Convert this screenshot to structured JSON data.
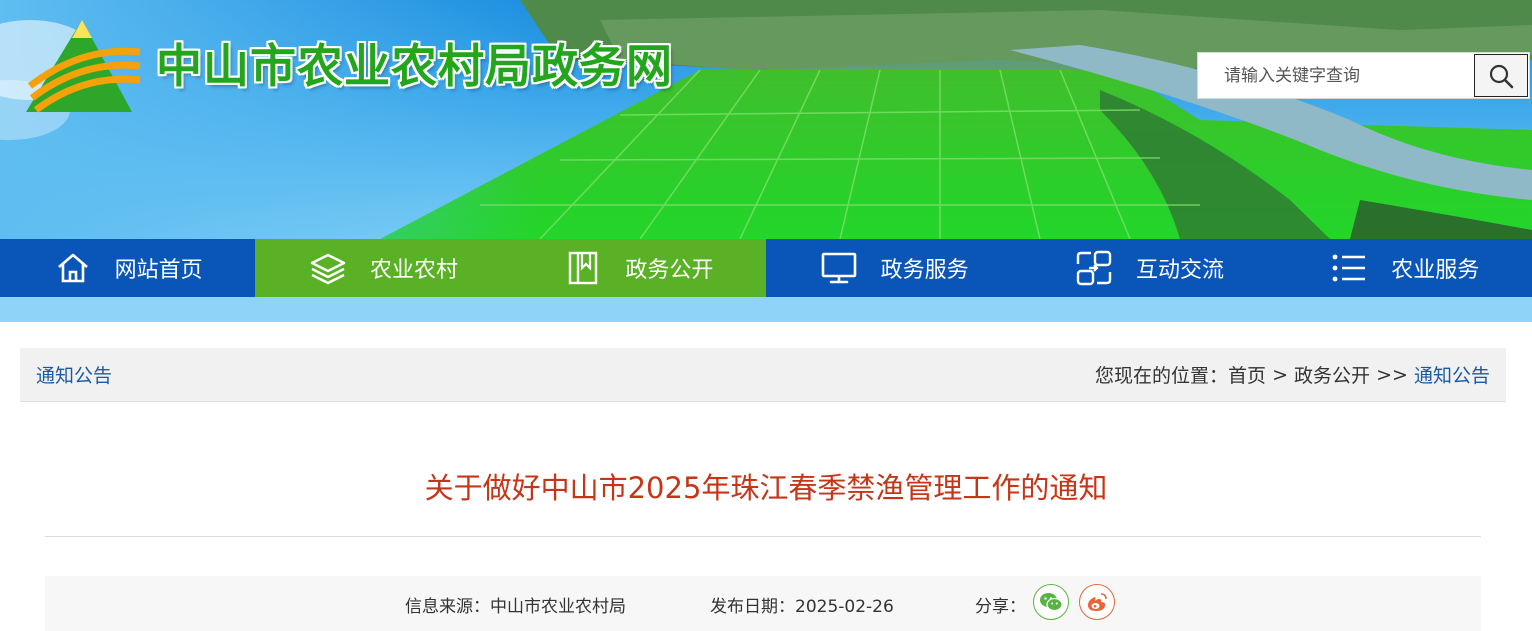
{
  "site": {
    "title": "中山市农业农村局政务网"
  },
  "search": {
    "placeholder": "请输入关键字查询"
  },
  "nav": {
    "items": [
      {
        "label": "网站首页",
        "icon": "home-icon"
      },
      {
        "label": "农业农村",
        "icon": "layers-icon"
      },
      {
        "label": "政务公开",
        "icon": "book-icon"
      },
      {
        "label": "政务服务",
        "icon": "monitor-icon"
      },
      {
        "label": "互动交流",
        "icon": "exchange-icon"
      },
      {
        "label": "农业服务",
        "icon": "list-icon"
      }
    ],
    "active_index": 1,
    "highlight_index": 2
  },
  "breadcrumb": {
    "section": "通知公告",
    "prefix": "您现在的位置：",
    "home": "首页",
    "sep1": " > ",
    "parent": "政务公开",
    "sep2": " >> ",
    "current": "通知公告"
  },
  "article": {
    "title": "关于做好中山市2025年珠江春季禁渔管理工作的通知",
    "source_label": "信息来源：",
    "source": "中山市农业农村局",
    "date_label": "发布日期：",
    "date": "2025-02-26",
    "share_label": "分享："
  },
  "colors": {
    "nav_blue": "#0a56b8",
    "nav_green": "#5bb125",
    "title_red": "#c53619",
    "link_blue": "#1b5aa3"
  }
}
